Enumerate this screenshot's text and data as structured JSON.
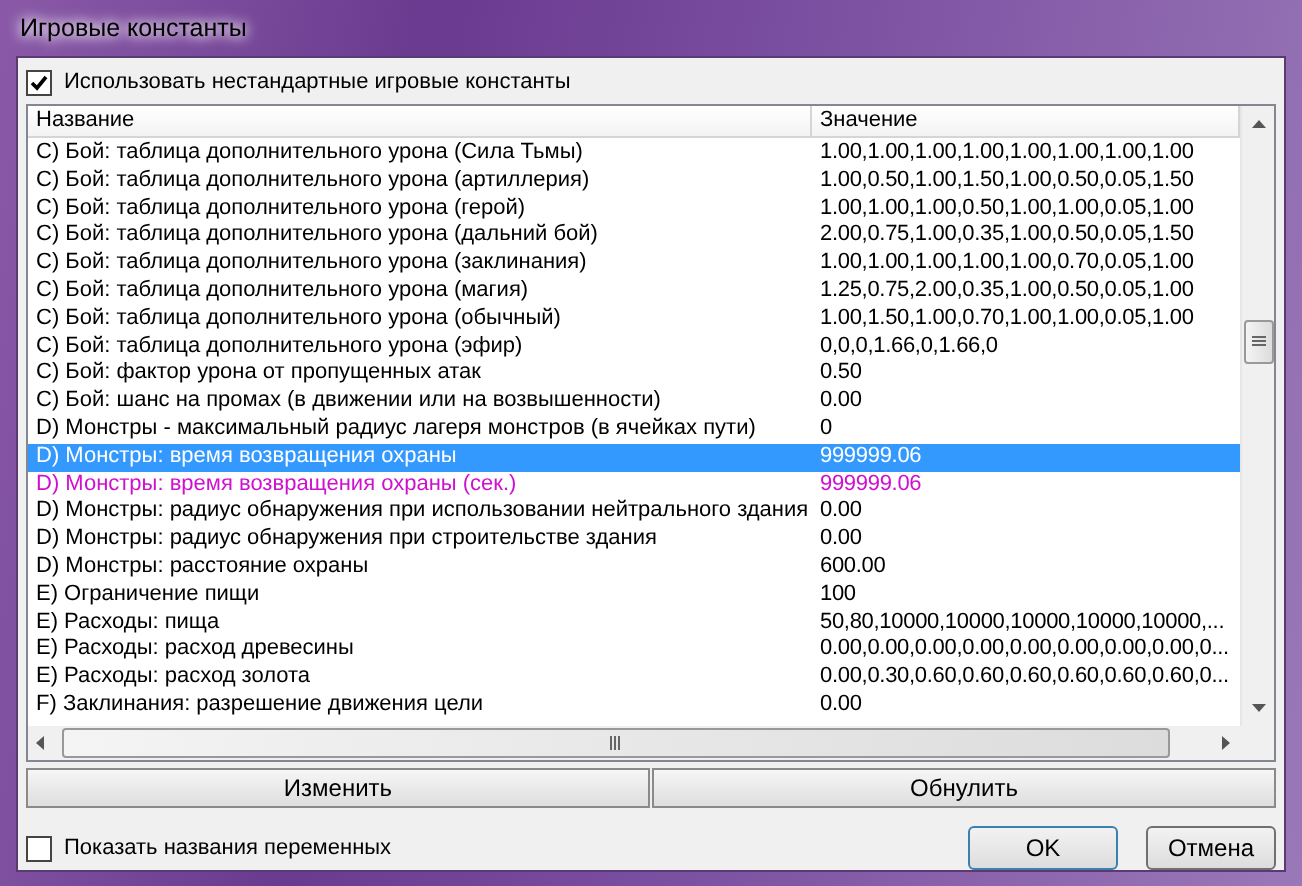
{
  "window": {
    "title": "Игровые константы"
  },
  "use_custom": {
    "label": "Использовать нестандартные игровые константы",
    "checked": true
  },
  "table": {
    "columns": [
      "Название",
      "Значение"
    ],
    "rows": [
      {
        "name": "C) Бой: таблица дополнительного урона (Сила Тьмы)",
        "value": "1.00,1.00,1.00,1.00,1.00,1.00,1.00,1.00",
        "selected": false,
        "modified": false
      },
      {
        "name": "C) Бой: таблица дополнительного урона (артиллерия)",
        "value": "1.00,0.50,1.00,1.50,1.00,0.50,0.05,1.50",
        "selected": false,
        "modified": false
      },
      {
        "name": "C) Бой: таблица дополнительного урона (герой)",
        "value": "1.00,1.00,1.00,0.50,1.00,1.00,0.05,1.00",
        "selected": false,
        "modified": false
      },
      {
        "name": "C) Бой: таблица дополнительного урона (дальний бой)",
        "value": "2.00,0.75,1.00,0.35,1.00,0.50,0.05,1.50",
        "selected": false,
        "modified": false
      },
      {
        "name": "C) Бой: таблица дополнительного урона (заклинания)",
        "value": "1.00,1.00,1.00,1.00,1.00,0.70,0.05,1.00",
        "selected": false,
        "modified": false
      },
      {
        "name": "C) Бой: таблица дополнительного урона (магия)",
        "value": "1.25,0.75,2.00,0.35,1.00,0.50,0.05,1.00",
        "selected": false,
        "modified": false
      },
      {
        "name": "C) Бой: таблица дополнительного урона (обычный)",
        "value": "1.00,1.50,1.00,0.70,1.00,1.00,0.05,1.00",
        "selected": false,
        "modified": false
      },
      {
        "name": "C) Бой: таблица дополнительного урона (эфир)",
        "value": "0,0,0,1.66,0,1.66,0",
        "selected": false,
        "modified": false
      },
      {
        "name": "C) Бой: фактор урона от пропущенных атак",
        "value": "0.50",
        "selected": false,
        "modified": false
      },
      {
        "name": "C) Бой: шанс на промах (в движении или на возвышенности)",
        "value": "0.00",
        "selected": false,
        "modified": false
      },
      {
        "name": "D) Монстры - максимальный радиус лагеря монстров (в ячейках пути)",
        "value": "0",
        "selected": false,
        "modified": false
      },
      {
        "name": "D) Монстры: время возвращения охраны",
        "value": "999999.06",
        "selected": true,
        "modified": false
      },
      {
        "name": "D) Монстры: время возвращения охраны (сек.)",
        "value": "999999.06",
        "selected": false,
        "modified": true
      },
      {
        "name": "D) Монстры: радиус обнаружения при использовании нейтрального здания",
        "value": "0.00",
        "selected": false,
        "modified": false
      },
      {
        "name": "D) Монстры: радиус обнаружения при строительстве здания",
        "value": "0.00",
        "selected": false,
        "modified": false
      },
      {
        "name": "D) Монстры: расстояние охраны",
        "value": "600.00",
        "selected": false,
        "modified": false
      },
      {
        "name": "E) Ограничение пищи",
        "value": "100",
        "selected": false,
        "modified": false
      },
      {
        "name": "E) Расходы: пища",
        "value": "50,80,10000,10000,10000,10000,10000,...",
        "selected": false,
        "modified": false
      },
      {
        "name": "E) Расходы: расход древесины",
        "value": "0.00,0.00,0.00,0.00,0.00,0.00,0.00,0.00,0...",
        "selected": false,
        "modified": false
      },
      {
        "name": "E) Расходы: расход золота",
        "value": "0.00,0.30,0.60,0.60,0.60,0.60,0.60,0.60,0...",
        "selected": false,
        "modified": false
      },
      {
        "name": "F) Заклинания: разрешение движения цели",
        "value": "0.00",
        "selected": false,
        "modified": false
      }
    ]
  },
  "actions": [
    "Изменить",
    "Обнулить"
  ],
  "show_names": {
    "label": "Показать названия переменных",
    "checked": false
  },
  "buttons": [
    "OK",
    "Отмена"
  ]
}
